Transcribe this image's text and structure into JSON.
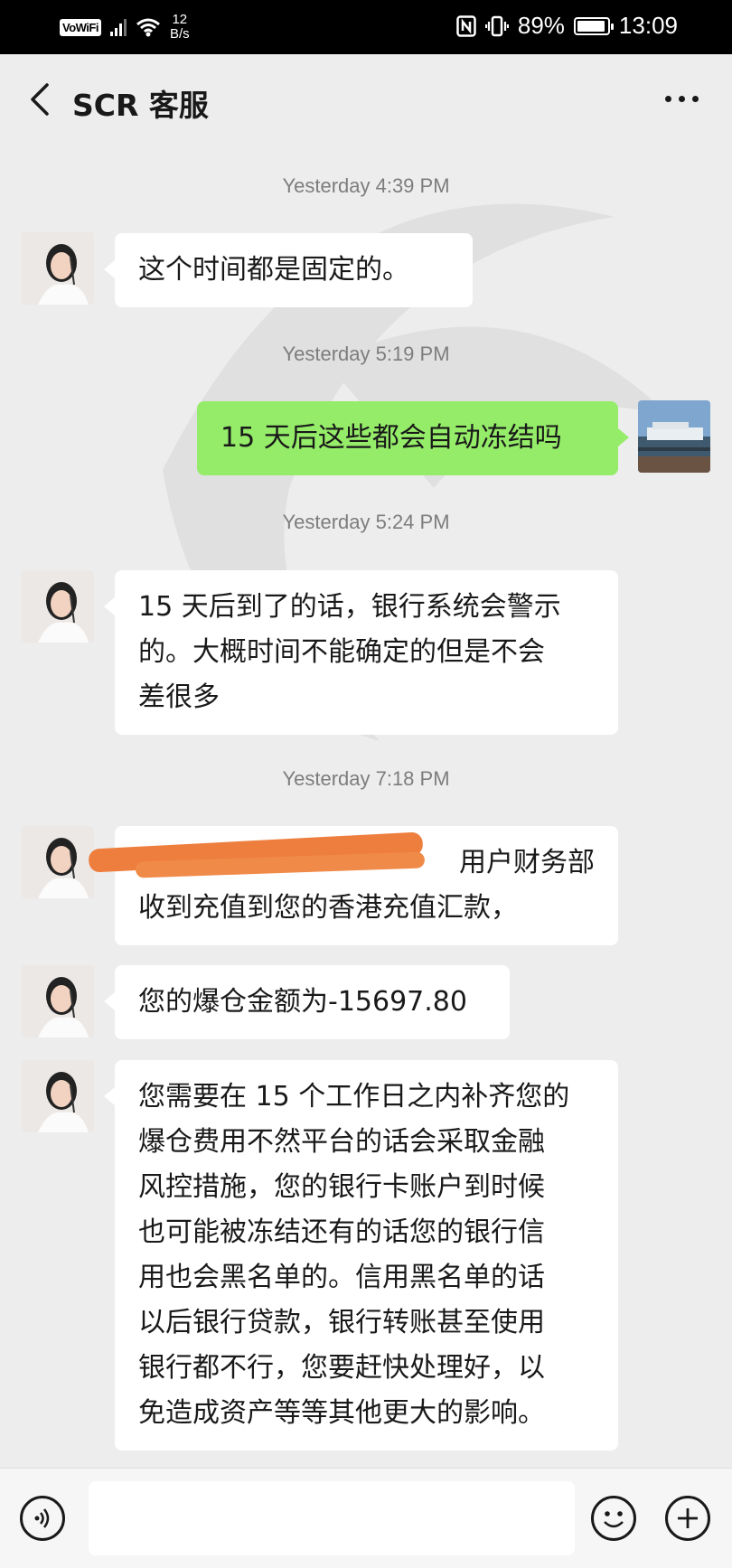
{
  "status_bar": {
    "network_label": "VoWiFi",
    "speed_value": "12",
    "speed_unit": "B/s",
    "battery": "89%",
    "time": "13:09"
  },
  "header": {
    "title": "SCR 客服",
    "back_icon": "chevron-left-icon",
    "more_icon": "more-icon"
  },
  "messages": [
    {
      "type": "time",
      "text": "Yesterday 4:39 PM"
    },
    {
      "type": "received",
      "lines": [
        "这个时间都是固定的。"
      ]
    },
    {
      "type": "time",
      "text": "Yesterday 5:19 PM"
    },
    {
      "type": "sent",
      "lines": [
        "15 天后这些都会自动冻结吗"
      ]
    },
    {
      "type": "time",
      "text": "Yesterday 5:24 PM"
    },
    {
      "type": "received",
      "lines": [
        "15 天后到了的话，银行系统会警示",
        "的。大概时间不能确定的但是不会",
        "差很多"
      ]
    },
    {
      "type": "time",
      "text": "Yesterday 7:18 PM"
    },
    {
      "type": "received",
      "lines": [
        "用户财务部",
        "收到充值到您的香港充值汇款，"
      ]
    },
    {
      "type": "received",
      "lines": [
        "您的爆仓金额为-15697.80"
      ]
    },
    {
      "type": "received",
      "lines": [
        "您需要在 15 个工作日之内补齐您的",
        "爆仓费用不然平台的话会采取金融",
        "风控措施，您的银行卡账户到时候",
        "也可能被冻结还有的话您的银行信",
        "用也会黑名单的。信用黑名单的话",
        "以后银行贷款，银行转账甚至使用",
        "银行都不行，您要赶快处理好，以",
        "免造成资产等等其他更大的影响。"
      ]
    }
  ],
  "input_bar": {
    "voice_icon": "voice-icon",
    "emoji_icon": "emoji-icon",
    "plus_icon": "plus-icon",
    "placeholder": ""
  },
  "colors": {
    "background": "#ededed",
    "sent_bubble": "#95ec69",
    "received_bubble": "#ffffff",
    "timestamp": "#7d7d7d"
  }
}
